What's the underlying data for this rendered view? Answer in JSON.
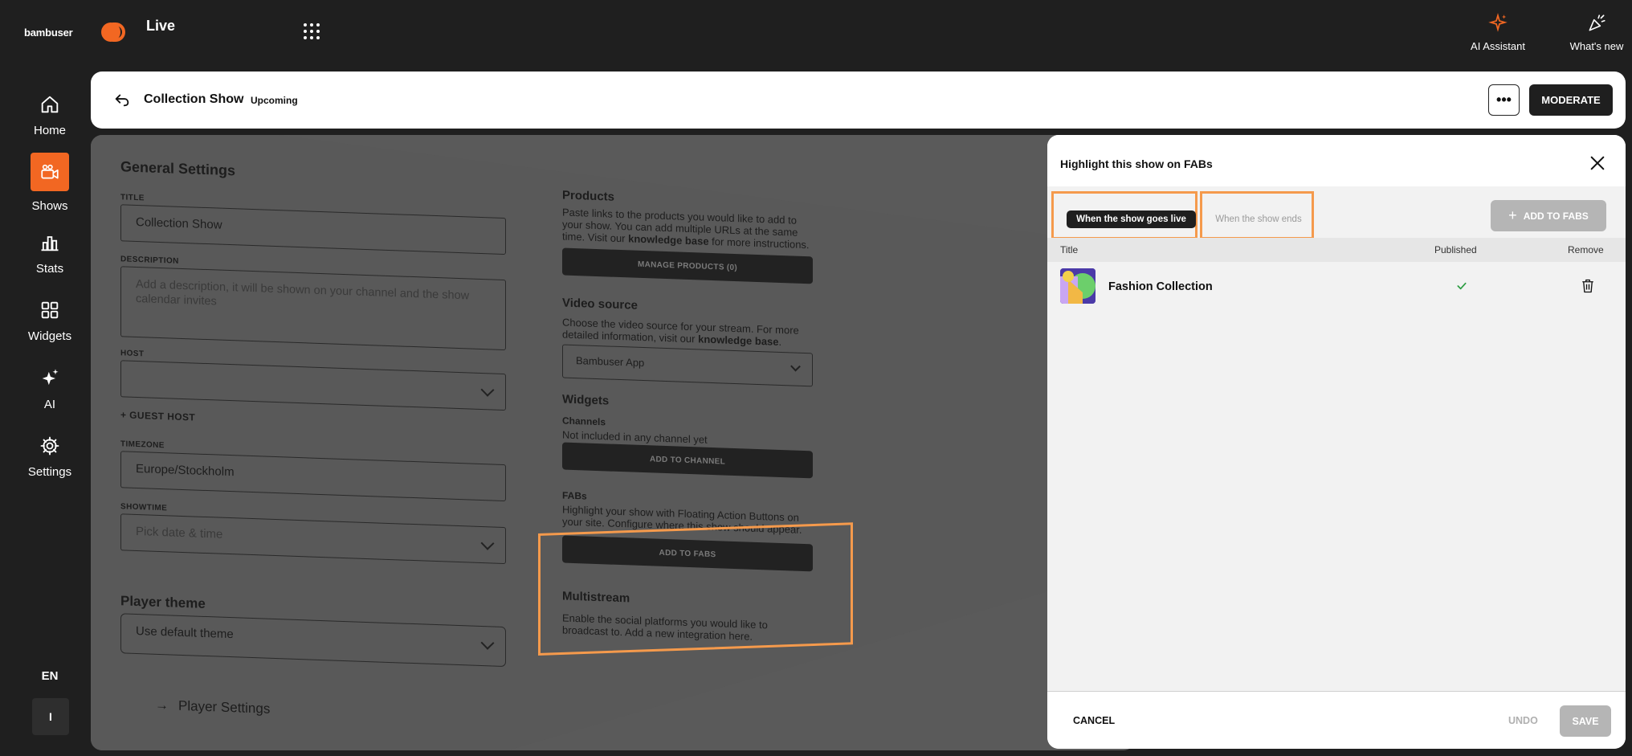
{
  "topbar": {
    "brand": "bambuser",
    "app_name": "Live",
    "ai_assistant_label": "AI Assistant",
    "whats_new_label": "What's new"
  },
  "sidenav": {
    "items": [
      {
        "label": "Home",
        "icon": "home-icon"
      },
      {
        "label": "Shows",
        "icon": "camera-icon",
        "active": true
      },
      {
        "label": "Stats",
        "icon": "bar-chart-icon"
      },
      {
        "label": "Widgets",
        "icon": "widgets-icon"
      },
      {
        "label": "AI",
        "icon": "sparkle-icon"
      },
      {
        "label": "Settings",
        "icon": "gear-icon"
      }
    ],
    "language": "EN",
    "avatar_initial": "I"
  },
  "header": {
    "title": "Collection Show",
    "status": "Upcoming",
    "moderate_label": "MODERATE"
  },
  "form": {
    "general_title": "General Settings",
    "title_label": "TITLE",
    "title_value": "Collection Show",
    "description_label": "DESCRIPTION",
    "description_placeholder": "Add a description, it will be shown on your channel and the show calendar invites",
    "host_label": "HOST",
    "guest_host": "+ GUEST HOST",
    "timezone_label": "TIMEZONE",
    "timezone_value": "Europe/Stockholm",
    "showtime_label": "SHOWTIME",
    "showtime_placeholder": "Pick date & time",
    "player_theme_title": "Player theme",
    "player_theme_value": "Use default theme",
    "player_settings": "Player Settings",
    "products_title": "Products",
    "products_text_pre": "Paste links to the products you would like to add to your show. You can add multiple URLs at the same time. Visit our ",
    "products_link": "knowledge base",
    "products_text_post": " for more instructions.",
    "manage_products": "MANAGE PRODUCTS (0)",
    "video_source_title": "Video source",
    "video_source_text_pre": "Choose the video source for your stream. For more detailed information, visit our ",
    "video_source_link": "knowledge base",
    "video_source_text_post": ".",
    "video_source_value": "Bambuser App",
    "widgets_title": "Widgets",
    "channels_label": "Channels",
    "channels_text": "Not included in any channel yet",
    "add_to_channel": "ADD TO CHANNEL",
    "fabs_label": "FABs",
    "fabs_text": "Highlight your show with Floating Action Buttons on your site. Configure where this show should appear.",
    "add_to_fabs": "ADD TO FABS",
    "multistream_title": "Multistream",
    "multistream_text": "Enable the social platforms you would like to broadcast to. Add a new integration here."
  },
  "drawer": {
    "title": "Highlight this show on FABs",
    "tabs": {
      "live": "When the show goes live",
      "ends": "When the show ends"
    },
    "add_to_fabs": "ADD TO FABS",
    "columns": {
      "title": "Title",
      "published": "Published",
      "remove": "Remove"
    },
    "rows": [
      {
        "title": "Fashion Collection",
        "published": true
      }
    ],
    "cancel": "CANCEL",
    "undo": "UNDO",
    "save": "SAVE"
  },
  "colors": {
    "accent": "#f26722",
    "highlight": "#f59a4c",
    "background": "#1f1f1f",
    "published_check": "#2e9e44"
  }
}
